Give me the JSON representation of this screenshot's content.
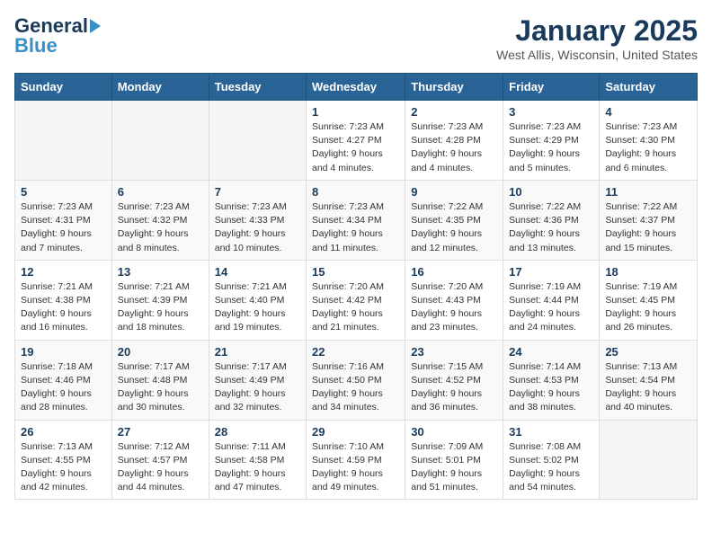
{
  "header": {
    "logo_general": "General",
    "logo_blue": "Blue",
    "month_title": "January 2025",
    "location": "West Allis, Wisconsin, United States"
  },
  "days_of_week": [
    "Sunday",
    "Monday",
    "Tuesday",
    "Wednesday",
    "Thursday",
    "Friday",
    "Saturday"
  ],
  "weeks": [
    [
      {
        "day": "",
        "info": ""
      },
      {
        "day": "",
        "info": ""
      },
      {
        "day": "",
        "info": ""
      },
      {
        "day": "1",
        "info": "Sunrise: 7:23 AM\nSunset: 4:27 PM\nDaylight: 9 hours and 4 minutes."
      },
      {
        "day": "2",
        "info": "Sunrise: 7:23 AM\nSunset: 4:28 PM\nDaylight: 9 hours and 4 minutes."
      },
      {
        "day": "3",
        "info": "Sunrise: 7:23 AM\nSunset: 4:29 PM\nDaylight: 9 hours and 5 minutes."
      },
      {
        "day": "4",
        "info": "Sunrise: 7:23 AM\nSunset: 4:30 PM\nDaylight: 9 hours and 6 minutes."
      }
    ],
    [
      {
        "day": "5",
        "info": "Sunrise: 7:23 AM\nSunset: 4:31 PM\nDaylight: 9 hours and 7 minutes."
      },
      {
        "day": "6",
        "info": "Sunrise: 7:23 AM\nSunset: 4:32 PM\nDaylight: 9 hours and 8 minutes."
      },
      {
        "day": "7",
        "info": "Sunrise: 7:23 AM\nSunset: 4:33 PM\nDaylight: 9 hours and 10 minutes."
      },
      {
        "day": "8",
        "info": "Sunrise: 7:23 AM\nSunset: 4:34 PM\nDaylight: 9 hours and 11 minutes."
      },
      {
        "day": "9",
        "info": "Sunrise: 7:22 AM\nSunset: 4:35 PM\nDaylight: 9 hours and 12 minutes."
      },
      {
        "day": "10",
        "info": "Sunrise: 7:22 AM\nSunset: 4:36 PM\nDaylight: 9 hours and 13 minutes."
      },
      {
        "day": "11",
        "info": "Sunrise: 7:22 AM\nSunset: 4:37 PM\nDaylight: 9 hours and 15 minutes."
      }
    ],
    [
      {
        "day": "12",
        "info": "Sunrise: 7:21 AM\nSunset: 4:38 PM\nDaylight: 9 hours and 16 minutes."
      },
      {
        "day": "13",
        "info": "Sunrise: 7:21 AM\nSunset: 4:39 PM\nDaylight: 9 hours and 18 minutes."
      },
      {
        "day": "14",
        "info": "Sunrise: 7:21 AM\nSunset: 4:40 PM\nDaylight: 9 hours and 19 minutes."
      },
      {
        "day": "15",
        "info": "Sunrise: 7:20 AM\nSunset: 4:42 PM\nDaylight: 9 hours and 21 minutes."
      },
      {
        "day": "16",
        "info": "Sunrise: 7:20 AM\nSunset: 4:43 PM\nDaylight: 9 hours and 23 minutes."
      },
      {
        "day": "17",
        "info": "Sunrise: 7:19 AM\nSunset: 4:44 PM\nDaylight: 9 hours and 24 minutes."
      },
      {
        "day": "18",
        "info": "Sunrise: 7:19 AM\nSunset: 4:45 PM\nDaylight: 9 hours and 26 minutes."
      }
    ],
    [
      {
        "day": "19",
        "info": "Sunrise: 7:18 AM\nSunset: 4:46 PM\nDaylight: 9 hours and 28 minutes."
      },
      {
        "day": "20",
        "info": "Sunrise: 7:17 AM\nSunset: 4:48 PM\nDaylight: 9 hours and 30 minutes."
      },
      {
        "day": "21",
        "info": "Sunrise: 7:17 AM\nSunset: 4:49 PM\nDaylight: 9 hours and 32 minutes."
      },
      {
        "day": "22",
        "info": "Sunrise: 7:16 AM\nSunset: 4:50 PM\nDaylight: 9 hours and 34 minutes."
      },
      {
        "day": "23",
        "info": "Sunrise: 7:15 AM\nSunset: 4:52 PM\nDaylight: 9 hours and 36 minutes."
      },
      {
        "day": "24",
        "info": "Sunrise: 7:14 AM\nSunset: 4:53 PM\nDaylight: 9 hours and 38 minutes."
      },
      {
        "day": "25",
        "info": "Sunrise: 7:13 AM\nSunset: 4:54 PM\nDaylight: 9 hours and 40 minutes."
      }
    ],
    [
      {
        "day": "26",
        "info": "Sunrise: 7:13 AM\nSunset: 4:55 PM\nDaylight: 9 hours and 42 minutes."
      },
      {
        "day": "27",
        "info": "Sunrise: 7:12 AM\nSunset: 4:57 PM\nDaylight: 9 hours and 44 minutes."
      },
      {
        "day": "28",
        "info": "Sunrise: 7:11 AM\nSunset: 4:58 PM\nDaylight: 9 hours and 47 minutes."
      },
      {
        "day": "29",
        "info": "Sunrise: 7:10 AM\nSunset: 4:59 PM\nDaylight: 9 hours and 49 minutes."
      },
      {
        "day": "30",
        "info": "Sunrise: 7:09 AM\nSunset: 5:01 PM\nDaylight: 9 hours and 51 minutes."
      },
      {
        "day": "31",
        "info": "Sunrise: 7:08 AM\nSunset: 5:02 PM\nDaylight: 9 hours and 54 minutes."
      },
      {
        "day": "",
        "info": ""
      }
    ]
  ]
}
